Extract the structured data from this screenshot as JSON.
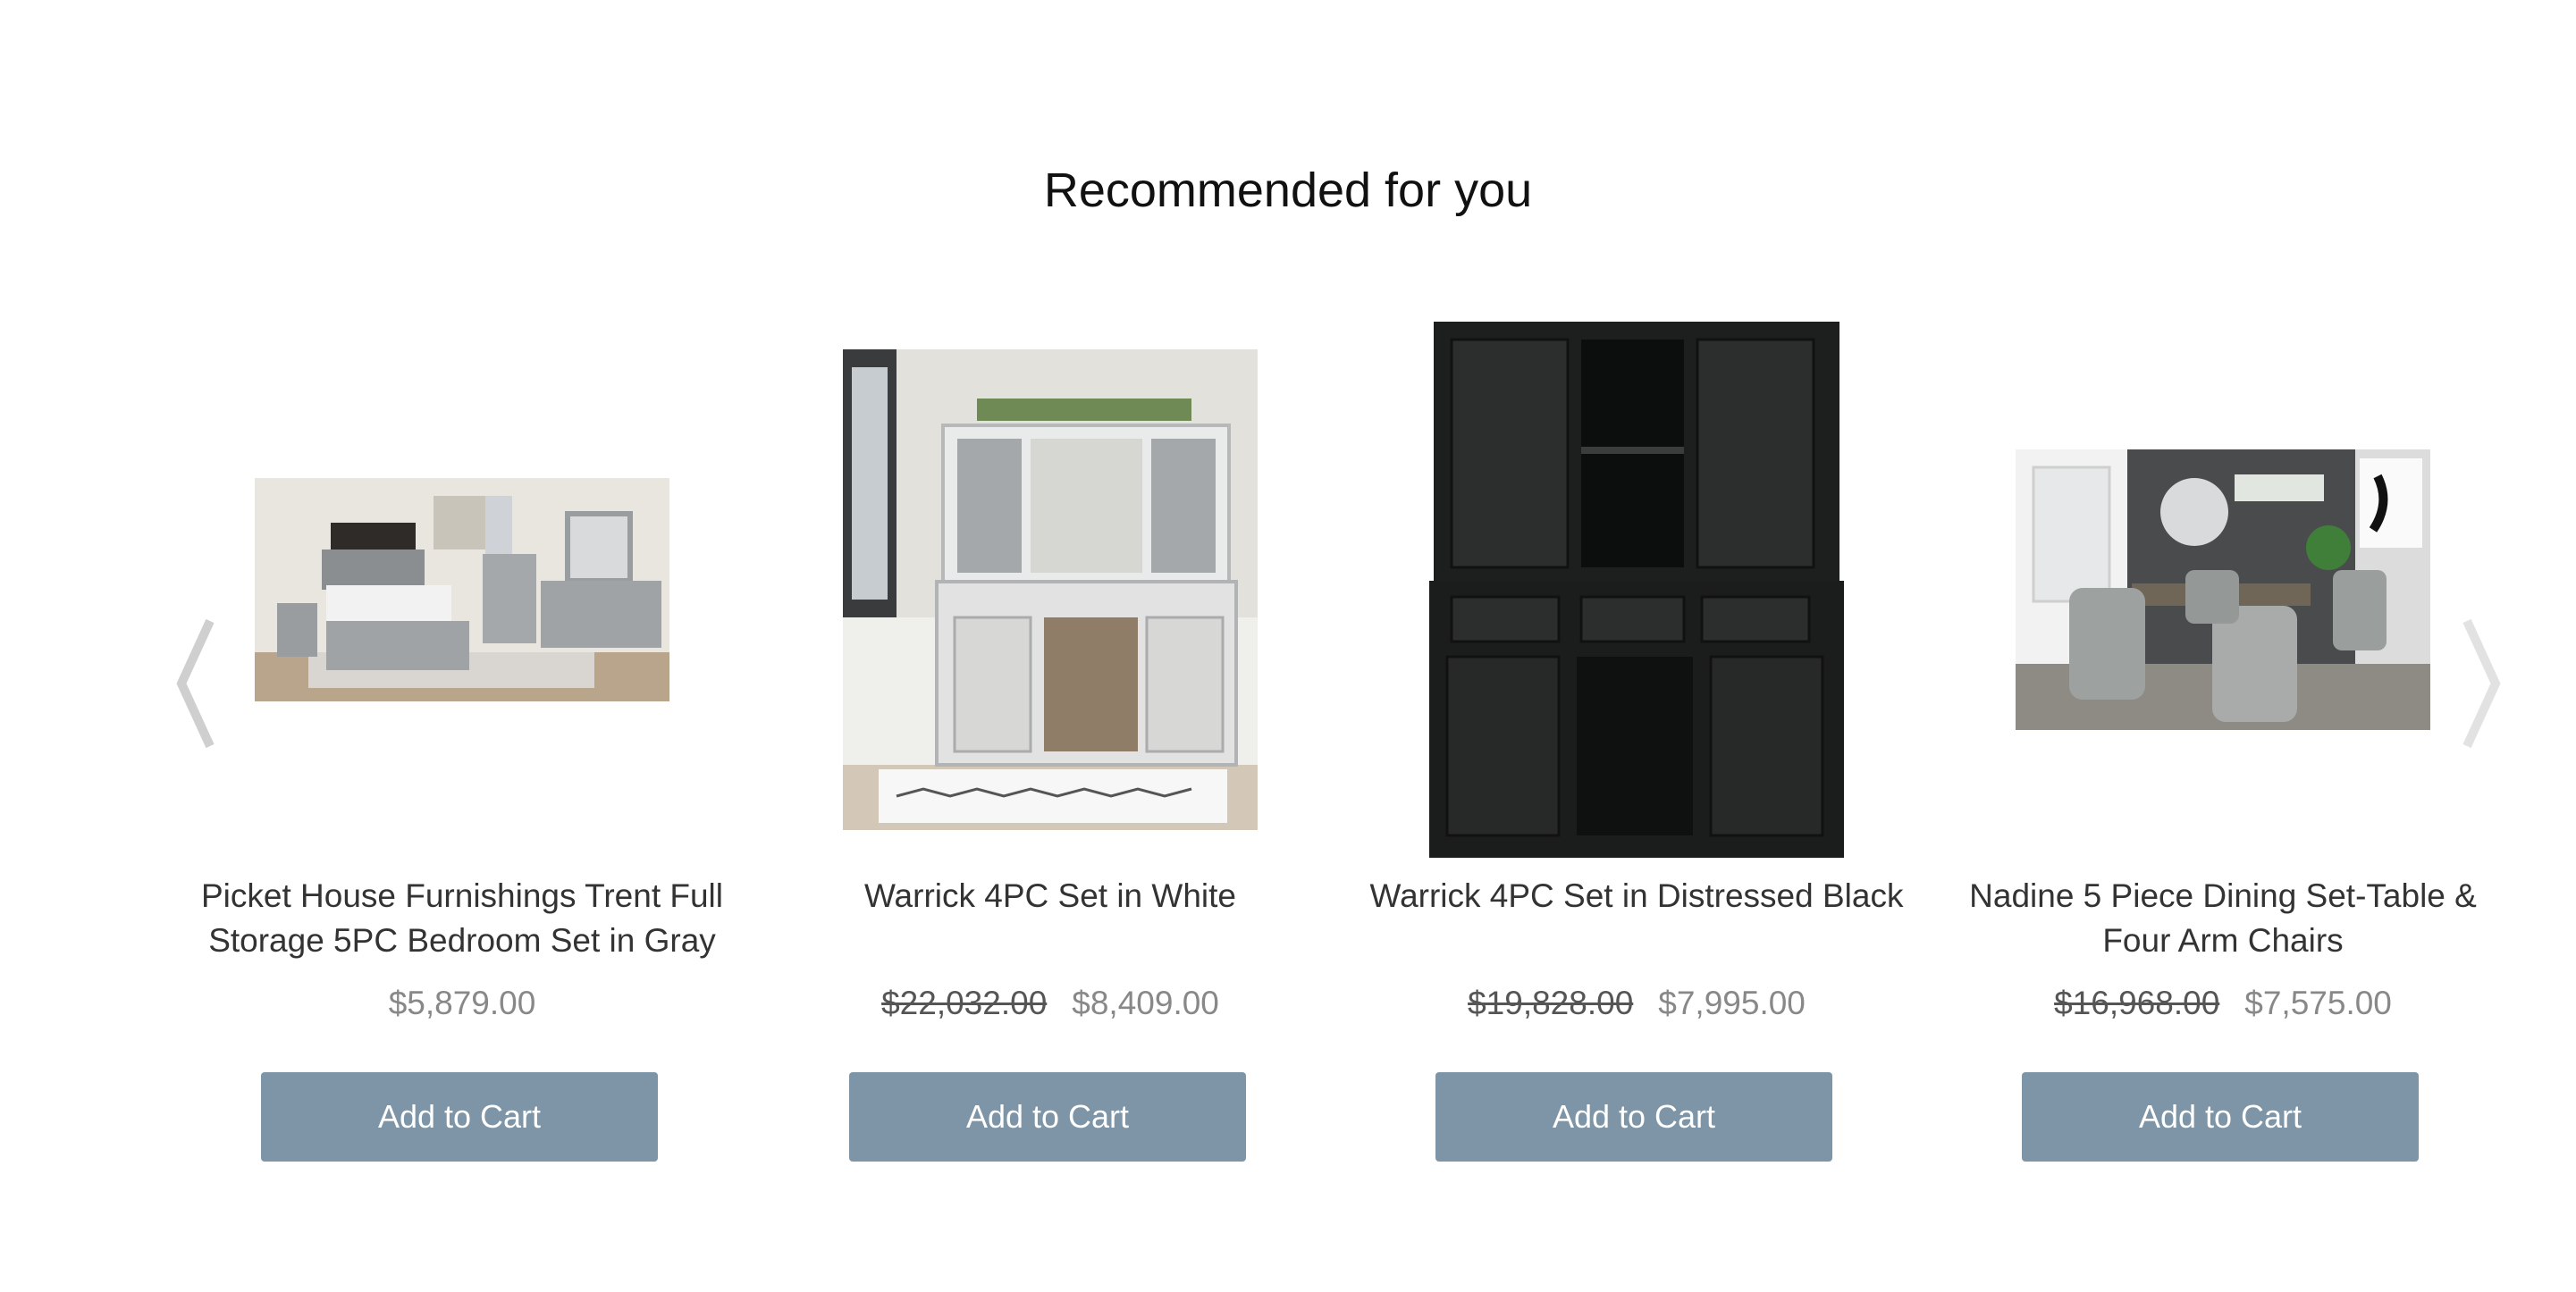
{
  "section": {
    "title": "Recommended for you"
  },
  "carousel": {
    "prev_icon": "chevron-left-icon",
    "next_icon": "chevron-right-icon"
  },
  "products": [
    {
      "title": "Picket House Furnishings Trent Full Storage 5PC Bedroom Set in Gray",
      "old_price": "",
      "price": "$5,879.00",
      "cart_label": "Add to Cart"
    },
    {
      "title": "Warrick 4PC Set in White",
      "old_price": "$22,032.00",
      "price": "$8,409.00",
      "cart_label": "Add to Cart"
    },
    {
      "title": "Warrick 4PC Set in Distressed Black",
      "old_price": "$19,828.00",
      "price": "$7,995.00",
      "cart_label": "Add to Cart"
    },
    {
      "title": "Nadine 5 Piece Dining Set-Table & Four Arm Chairs",
      "old_price": "$16,968.00",
      "price": "$7,575.00",
      "cart_label": "Add to Cart"
    }
  ],
  "colors": {
    "button": "#7d95a7",
    "arrow": "#d0d0d0"
  }
}
